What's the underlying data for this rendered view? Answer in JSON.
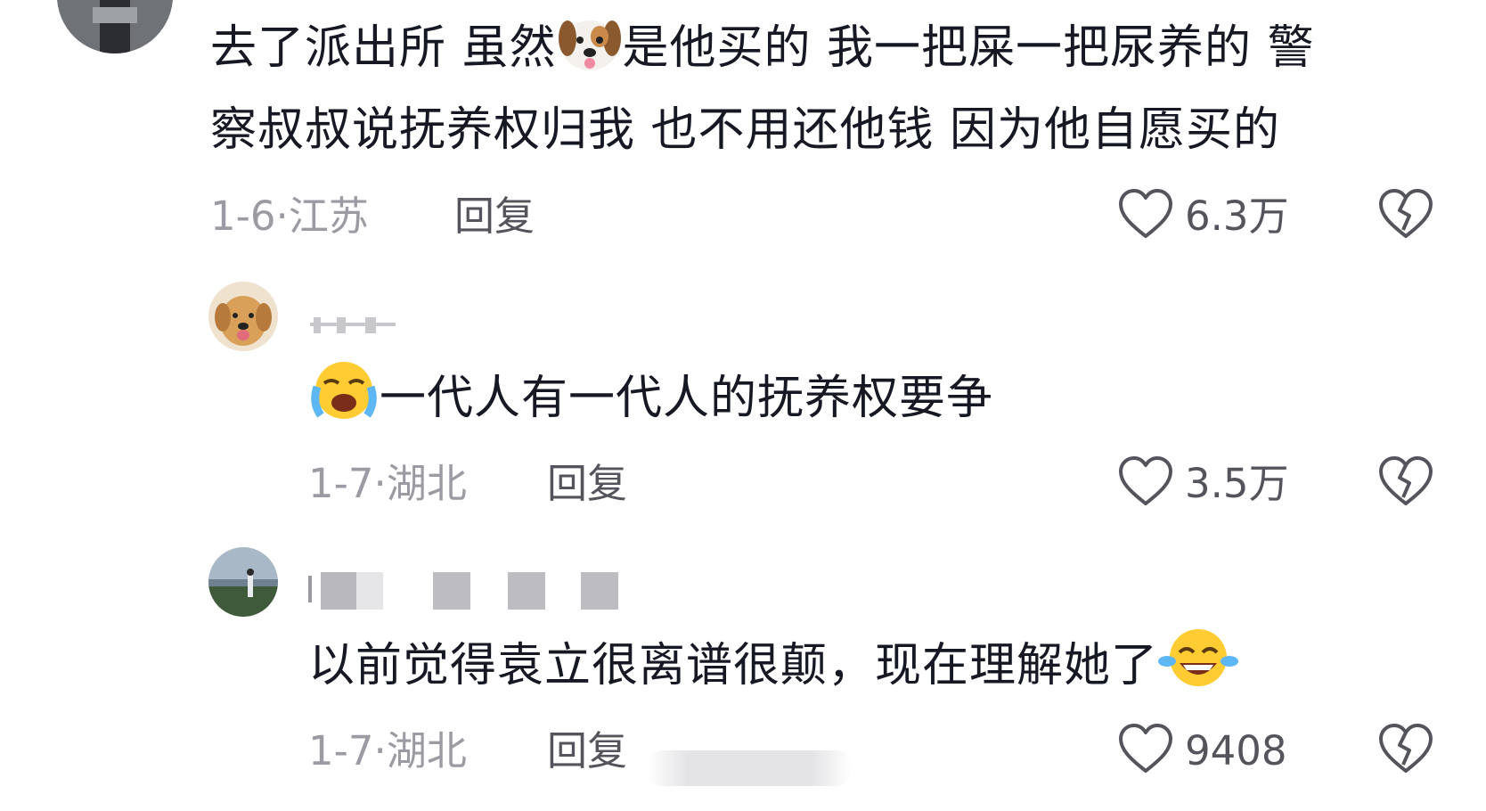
{
  "comments": [
    {
      "lines": [
        "去了派出所 虽然",
        "是他买的 我一把屎一把尿养的 警",
        "察叔叔说抚养权归我 也不用还他钱 因为他自愿买的"
      ],
      "inline_emoji": "dog-face-emoji",
      "date": "1-6",
      "location": "江苏",
      "reply_label": "回复",
      "likes": "6.3万"
    },
    {
      "username": "",
      "text": "一代人有一代人的抚养权要争",
      "leading_emoji": "loudly-crying-emoji",
      "date": "1-7",
      "location": "湖北",
      "reply_label": "回复",
      "likes": "3.5万"
    },
    {
      "username": "",
      "text": "以前觉得袁立很离谱很颠，现在理解她了",
      "trailing_emoji": "tears-of-joy-emoji",
      "date": "1-7",
      "location": "湖北",
      "reply_label": "回复",
      "likes": "9408"
    }
  ],
  "separator": "·"
}
